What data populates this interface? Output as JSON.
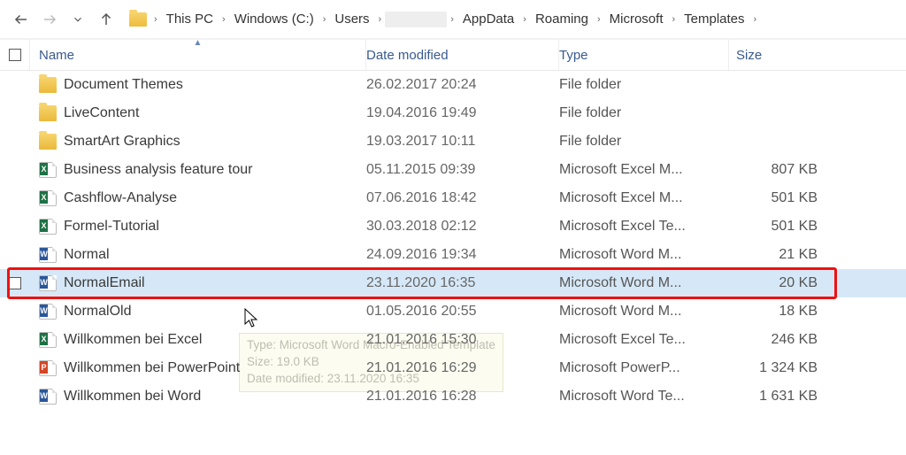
{
  "nav": {
    "back_enabled": true,
    "forward_enabled": false,
    "recent_enabled": true,
    "up_enabled": true
  },
  "breadcrumb": {
    "segments": [
      "This PC",
      "Windows (C:)",
      "Users",
      "",
      "AppData",
      "Roaming",
      "Microsoft",
      "Templates"
    ],
    "redacted_index": 3
  },
  "columns": {
    "name": "Name",
    "date": "Date modified",
    "type": "Type",
    "size": "Size",
    "sort_column": "name",
    "sort_dir": "asc"
  },
  "files": [
    {
      "icon": "folder",
      "name": "Document Themes",
      "date": "26.02.2017 20:24",
      "type": "File folder",
      "size": ""
    },
    {
      "icon": "folder",
      "name": "LiveContent",
      "date": "19.04.2016 19:49",
      "type": "File folder",
      "size": ""
    },
    {
      "icon": "folder",
      "name": "SmartArt Graphics",
      "date": "19.03.2017 10:11",
      "type": "File folder",
      "size": ""
    },
    {
      "icon": "excel",
      "name": "Business analysis feature tour",
      "date": "05.11.2015 09:39",
      "type": "Microsoft Excel M...",
      "size": "807 KB"
    },
    {
      "icon": "excel",
      "name": "Cashflow-Analyse",
      "date": "07.06.2016 18:42",
      "type": "Microsoft Excel M...",
      "size": "501 KB"
    },
    {
      "icon": "excel",
      "name": "Formel-Tutorial",
      "date": "30.03.2018 02:12",
      "type": "Microsoft Excel Te...",
      "size": "501 KB"
    },
    {
      "icon": "word",
      "name": "Normal",
      "date": "24.09.2016 19:34",
      "type": "Microsoft Word M...",
      "size": "21 KB"
    },
    {
      "icon": "word",
      "name": "NormalEmail",
      "date": "23.11.2020 16:35",
      "type": "Microsoft Word M...",
      "size": "20 KB",
      "selected": true,
      "highlighted": true
    },
    {
      "icon": "word",
      "name": "NormalOld",
      "date": "01.05.2016 20:55",
      "type": "Microsoft Word M...",
      "size": "18 KB"
    },
    {
      "icon": "excel",
      "name": "Willkommen bei Excel",
      "date": "21.01.2016 15:30",
      "type": "Microsoft Excel Te...",
      "size": "246 KB"
    },
    {
      "icon": "ppt",
      "name": "Willkommen bei PowerPoint",
      "date": "21.01.2016 16:29",
      "type": "Microsoft PowerP...",
      "size": "1 324 KB"
    },
    {
      "icon": "word",
      "name": "Willkommen bei Word",
      "date": "21.01.2016 16:28",
      "type": "Microsoft Word Te...",
      "size": "1 631 KB"
    }
  ],
  "tooltip": {
    "line1": "Type: Microsoft Word Macro-Enabled Template",
    "line2": "Size: 19.0 KB",
    "line3": "Date modified: 23.11.2020 16:35"
  }
}
